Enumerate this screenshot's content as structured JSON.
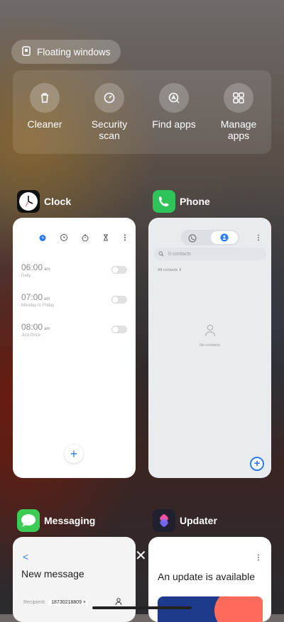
{
  "floating": {
    "label": "Floating windows",
    "icon": "floating-window-icon"
  },
  "quick_actions": [
    {
      "label_lines": [
        "Cleaner"
      ],
      "icon": "trash-icon"
    },
    {
      "label_lines": [
        "Security",
        "scan"
      ],
      "icon": "security-scan-icon"
    },
    {
      "label_lines": [
        "Find apps"
      ],
      "icon": "find-apps-icon"
    },
    {
      "label_lines": [
        "Manage",
        "apps"
      ],
      "icon": "manage-apps-icon"
    }
  ],
  "apps": {
    "clock": {
      "name": "Clock",
      "alarms": [
        {
          "time": "06:00",
          "ampm": "am",
          "repeat": "Daily"
        },
        {
          "time": "07:00",
          "ampm": "am",
          "repeat": "Monday to Friday"
        },
        {
          "time": "08:00",
          "ampm": "am",
          "repeat": "Just Once"
        }
      ],
      "add_label": "+"
    },
    "phone": {
      "name": "Phone",
      "search_placeholder": "0 contacts",
      "filter": "All contacts",
      "empty": "No contacts",
      "add_label": "+"
    },
    "messaging": {
      "name": "Messaging",
      "back": "<",
      "title": "New message",
      "recipient_label": "Recipient:",
      "recipient_value": "18730218809"
    },
    "updater": {
      "name": "Updater",
      "title": "An update is available"
    }
  },
  "close_symbol": "✕",
  "colors": {
    "accent": "#2b7bf5",
    "phone_green": "#2fc45a",
    "messaging_green": "#3ccc56",
    "updater_bg": "#1f1f2e"
  }
}
